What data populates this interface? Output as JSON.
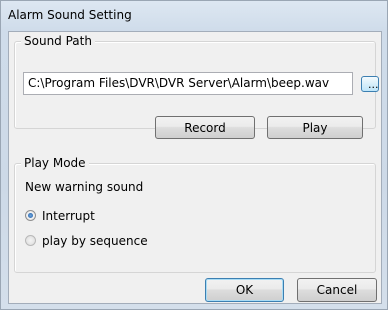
{
  "window": {
    "title": "Alarm Sound Setting"
  },
  "sound_path": {
    "label": "Sound Path",
    "value": "C:\\Program Files\\DVR\\DVR Server\\Alarm\\beep.wav",
    "browse_label": "...",
    "record_label": "Record",
    "play_label": "Play"
  },
  "play_mode": {
    "label": "Play Mode",
    "subtitle": "New warning sound",
    "options": [
      {
        "label": "Interrupt",
        "selected": true
      },
      {
        "label": "play by sequence",
        "selected": false
      }
    ]
  },
  "footer": {
    "ok_label": "OK",
    "cancel_label": "Cancel"
  }
}
